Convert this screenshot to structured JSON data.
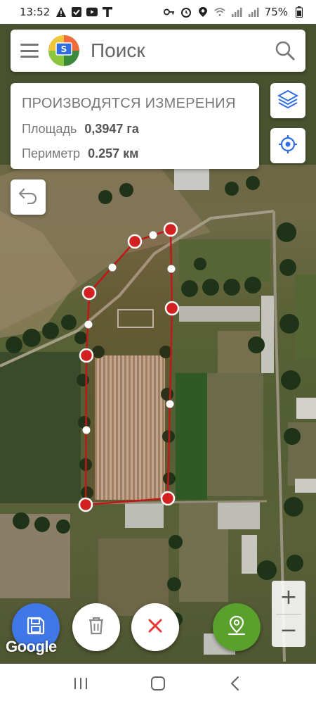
{
  "status_bar": {
    "time": "13:52",
    "battery": "75%",
    "left_icons": [
      "warning-icon",
      "check-square-icon",
      "youtube-icon",
      "t-icon"
    ],
    "right_icons": [
      "key-icon",
      "alarm-icon",
      "location-icon",
      "wifi-icon",
      "signal-icon",
      "signal-icon",
      "battery-icon"
    ]
  },
  "search": {
    "placeholder": "Поиск",
    "icons": [
      "menu-icon",
      "app-logo",
      "search-icon"
    ]
  },
  "measurement": {
    "title": "ПРОИЗВОДЯТСЯ ИЗМЕРЕНИЯ",
    "area_label": "Площадь",
    "area_value": "0,3947 га",
    "perimeter_label": "Периметр",
    "perimeter_value": "0.257 км"
  },
  "map": {
    "attribution": "Google",
    "zoom_in": "+",
    "zoom_out": "−",
    "vertex_count": 8,
    "midpoint_count": 7
  },
  "actions": {
    "save": "save-icon",
    "delete": "trash-icon",
    "cancel": "close-icon",
    "place": "map-pin-icon"
  },
  "colors": {
    "accent": "#3f77e6",
    "vertex": "#d32020",
    "outline": "#c01818",
    "place_button": "#5aa02c",
    "cancel_x": "#e53935"
  },
  "nav": {
    "buttons": [
      "recent-apps-icon",
      "home-icon",
      "back-icon"
    ]
  }
}
